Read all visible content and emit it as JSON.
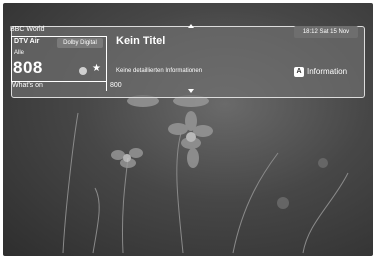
{
  "banner": {
    "source": "BBC World",
    "sub_label": "DTV Air",
    "audio_badge": "Dolby Digital",
    "group": "Alle",
    "channel_number": "808",
    "whats_on": "What's on",
    "channel_ref": "800",
    "program_title": "Kein Titel",
    "program_info": "Keine detaillierten Informationen",
    "clock": "18:12 Sat 15 Nov",
    "info_key": "A",
    "info_label": "Information"
  },
  "icons": {
    "dot": "record-dot-icon",
    "star": "favorite-star-icon",
    "up": "arrow-up-icon",
    "down": "arrow-down-icon"
  },
  "colors": {
    "panel_border": "#dcdcdc",
    "panel_bg": "#6e6e6e",
    "text": "#ffffff"
  }
}
